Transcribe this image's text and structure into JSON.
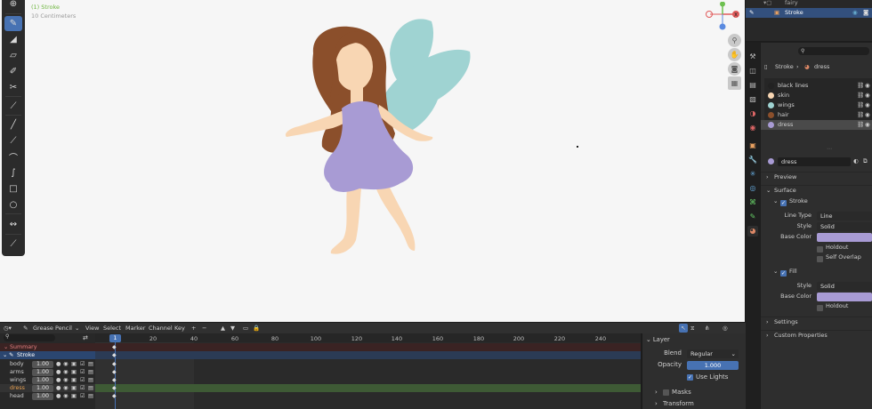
{
  "viewport": {
    "hud": [
      "(1) Stroke",
      "10 Centimeters"
    ],
    "tools": [
      "cursor-icon",
      "draw-icon",
      "fill-icon",
      "erase-icon",
      "tint-icon",
      "cutter-icon",
      "eyedropper-icon",
      "line-icon",
      "polyline-icon",
      "arc-icon",
      "curve-icon",
      "box-icon",
      "circle-icon",
      "interpolate-icon",
      "measure-icon"
    ],
    "gizmo": {
      "x_label": "X",
      "y_label": "Y"
    }
  },
  "outliner": {
    "rows": [
      {
        "name": "fairy",
        "selected": false
      },
      {
        "name": "Stroke",
        "selected": true
      }
    ]
  },
  "properties": {
    "breadcrumb": {
      "object": "Stroke",
      "material": "dress"
    },
    "materials": [
      {
        "name": "black lines",
        "color": "#222222"
      },
      {
        "name": "skin",
        "color": "#f8d6b3"
      },
      {
        "name": "wings",
        "color": "#9fd3d2"
      },
      {
        "name": "hair",
        "color": "#8b4f2b"
      },
      {
        "name": "dress",
        "color": "#a89bd4",
        "active": true
      }
    ],
    "active_material": "dress",
    "panels": {
      "preview": "Preview",
      "surface": "Surface",
      "stroke": "Stroke",
      "fill": "Fill",
      "settings": "Settings",
      "custom": "Custom Properties"
    },
    "stroke": {
      "line_type_label": "Line Type",
      "line_type": "Line",
      "style_label": "Style",
      "style": "Solid",
      "base_color_label": "Base Color",
      "base_color": "#a89bd4",
      "holdout": "Holdout",
      "self_overlap": "Self Overlap"
    },
    "fill": {
      "style_label": "Style",
      "style": "Solid",
      "base_color_label": "Base Color",
      "base_color": "#a89bd4",
      "holdout": "Holdout"
    }
  },
  "dopesheet": {
    "header": {
      "mode": "Grease Pencil",
      "menus": [
        "View",
        "Select",
        "Marker",
        "Channel",
        "Key"
      ]
    },
    "current_frame": "1",
    "frames": [
      "20",
      "40",
      "60",
      "80",
      "100",
      "120",
      "140",
      "160",
      "180",
      "200",
      "220",
      "240"
    ],
    "summary": "Summary",
    "object": "Stroke",
    "layers": [
      {
        "name": "body",
        "value": "1.00"
      },
      {
        "name": "arms",
        "value": "1.00"
      },
      {
        "name": "wings",
        "value": "1.00"
      },
      {
        "name": "dress",
        "value": "1.00",
        "active": true
      },
      {
        "name": "head",
        "value": "1.00"
      }
    ],
    "layer_panel": {
      "title": "Layer",
      "blend_label": "Blend",
      "blend": "Regular",
      "opacity_label": "Opacity",
      "opacity": "1.000",
      "use_lights": "Use Lights",
      "masks": "Masks",
      "transform": "Transform"
    }
  },
  "colors": {
    "accent": "#4772b3",
    "active_row": "#3a5f94",
    "key_row": "#3e5a35",
    "frame_marker": "#4772b3"
  }
}
